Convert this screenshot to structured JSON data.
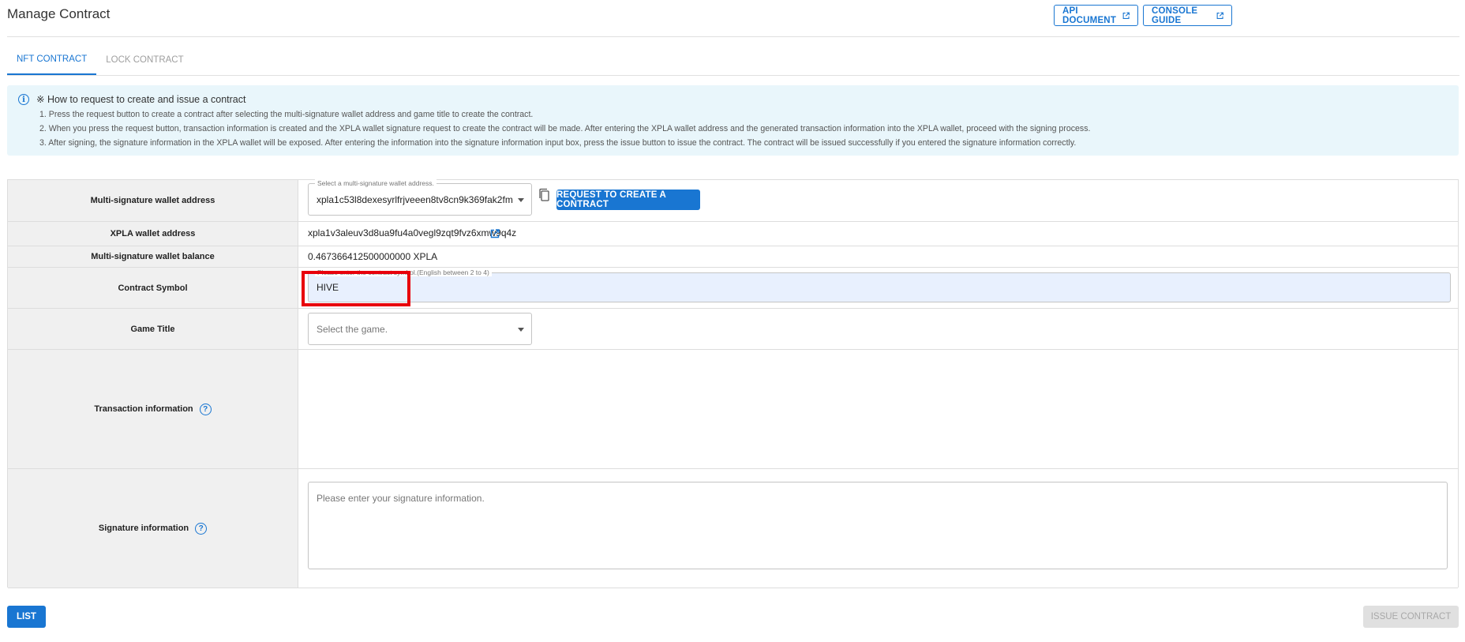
{
  "header": {
    "title": "Manage Contract",
    "api_document_label": "API DOCUMENT",
    "console_guide_label": "CONSOLE GUIDE"
  },
  "tabs": [
    {
      "label": "NFT CONTRACT",
      "active": true
    },
    {
      "label": "LOCK CONTRACT",
      "active": false
    }
  ],
  "info": {
    "title": "※ How to request to create and issue a contract",
    "lines": [
      "1. Press the request button to create a contract after selecting the multi-signature wallet address and game title to create the contract.",
      "2. When you press the request button, transaction information is created and the XPLA wallet signature request to create the contract will be made. After entering the XPLA wallet address and the generated transaction information into the XPLA wallet, proceed with the signing process.",
      "3. After signing, the signature information in the XPLA wallet will be exposed. After entering the information into the signature information input box, press the issue button to issue the contract. The contract will be issued successfully if you entered the signature information correctly."
    ]
  },
  "form": {
    "multisig": {
      "label": "Multi-signature wallet address",
      "field_label": "Select a multi-signature wallet address.",
      "value": "xpla1c53l8dexesyrlfrjveeen8tv8cn9k369fak2fm",
      "request_button": "REQUEST TO CREATE A CONTRACT"
    },
    "xpla_wallet": {
      "label": "XPLA wallet address",
      "value": "xpla1v3aleuv3d8ua9fu4a0vegl9zqt9fvz6xmw9q4z"
    },
    "balance": {
      "label": "Multi-signature wallet balance",
      "value": "0.467366412500000000 XPLA"
    },
    "symbol": {
      "label": "Contract Symbol",
      "field_label": "Please enter the contract symbol.(English between 2 to 4)",
      "value": "HIVE"
    },
    "game": {
      "label": "Game Title",
      "placeholder": "Select the game."
    },
    "transaction": {
      "label": "Transaction information"
    },
    "signature": {
      "label": "Signature information",
      "placeholder": "Please enter your signature information."
    }
  },
  "footer": {
    "list_button": "LIST",
    "issue_button": "ISSUE CONTRACT"
  },
  "colors": {
    "primary": "#1976d2",
    "info_bg": "#e9f6fb",
    "highlight": "#e8000b"
  }
}
